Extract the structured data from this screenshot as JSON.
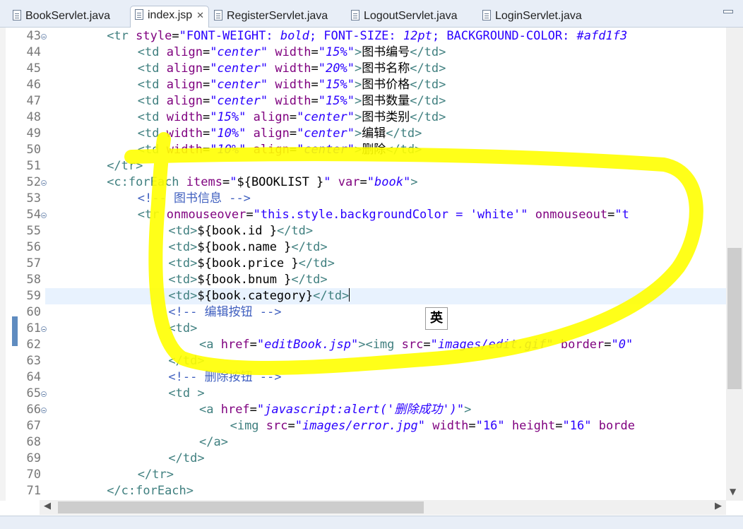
{
  "tabs": [
    {
      "label": "BookServlet.java",
      "active": false
    },
    {
      "label": "index.jsp",
      "active": true,
      "close": "✕"
    },
    {
      "label": "RegisterServlet.java",
      "active": false
    },
    {
      "label": "LogoutServlet.java",
      "active": false
    },
    {
      "label": "LoginServlet.java",
      "active": false
    }
  ],
  "editor": {
    "line_numbers": [
      "43",
      "44",
      "45",
      "46",
      "47",
      "48",
      "49",
      "50",
      "51",
      "52",
      "53",
      "54",
      "55",
      "56",
      "57",
      "58",
      "59",
      "60",
      "61",
      "62",
      "63",
      "64",
      "65",
      "66",
      "67",
      "68",
      "69",
      "70",
      "71"
    ],
    "current_line": "59"
  },
  "ime_indicator": "英",
  "colors": {
    "tag": "#3f7f7f",
    "attribute": "#7f007f",
    "string": "#2a00ff",
    "comment": "#3f5fbf",
    "highlight": "#ffff00",
    "current_line_bg": "#e8f2fe"
  },
  "code": [
    {
      "n": "43",
      "indent": 8,
      "fold": true,
      "parts": [
        [
          "t",
          "<tr "
        ],
        [
          "a",
          "style"
        ],
        [
          "x",
          "="
        ],
        [
          "sn",
          "\"FONT-WEIGHT: "
        ],
        [
          "s",
          "bold"
        ],
        [
          "sn",
          "; FONT-SIZE: "
        ],
        [
          "s",
          "12pt"
        ],
        [
          "sn",
          "; BACKGROUND-COLOR: "
        ],
        [
          "s",
          "#afd1f3"
        ]
      ]
    },
    {
      "n": "44",
      "indent": 12,
      "parts": [
        [
          "t",
          "<td "
        ],
        [
          "a",
          "align"
        ],
        [
          "x",
          "="
        ],
        [
          "s",
          "\"center\""
        ],
        [
          "x",
          " "
        ],
        [
          "a",
          "width"
        ],
        [
          "x",
          "="
        ],
        [
          "s",
          "\"15%\""
        ],
        [
          "t",
          ">"
        ],
        [
          "x",
          "图书编号"
        ],
        [
          "t",
          "</td>"
        ]
      ]
    },
    {
      "n": "45",
      "indent": 12,
      "parts": [
        [
          "t",
          "<td "
        ],
        [
          "a",
          "align"
        ],
        [
          "x",
          "="
        ],
        [
          "s",
          "\"center\""
        ],
        [
          "x",
          " "
        ],
        [
          "a",
          "width"
        ],
        [
          "x",
          "="
        ],
        [
          "s",
          "\"20%\""
        ],
        [
          "t",
          ">"
        ],
        [
          "x",
          "图书名称"
        ],
        [
          "t",
          "</td>"
        ]
      ]
    },
    {
      "n": "46",
      "indent": 12,
      "parts": [
        [
          "t",
          "<td "
        ],
        [
          "a",
          "align"
        ],
        [
          "x",
          "="
        ],
        [
          "s",
          "\"center\""
        ],
        [
          "x",
          " "
        ],
        [
          "a",
          "width"
        ],
        [
          "x",
          "="
        ],
        [
          "s",
          "\"15%\""
        ],
        [
          "t",
          ">"
        ],
        [
          "x",
          "图书价格"
        ],
        [
          "t",
          "</td>"
        ]
      ]
    },
    {
      "n": "47",
      "indent": 12,
      "parts": [
        [
          "t",
          "<td "
        ],
        [
          "a",
          "align"
        ],
        [
          "x",
          "="
        ],
        [
          "s",
          "\"center\""
        ],
        [
          "x",
          " "
        ],
        [
          "a",
          "width"
        ],
        [
          "x",
          "="
        ],
        [
          "s",
          "\"15%\""
        ],
        [
          "t",
          ">"
        ],
        [
          "x",
          "图书数量"
        ],
        [
          "t",
          "</td>"
        ]
      ]
    },
    {
      "n": "48",
      "indent": 12,
      "parts": [
        [
          "t",
          "<td "
        ],
        [
          "a",
          "width"
        ],
        [
          "x",
          "="
        ],
        [
          "s",
          "\"15%\""
        ],
        [
          "x",
          " "
        ],
        [
          "a",
          "align"
        ],
        [
          "x",
          "="
        ],
        [
          "s",
          "\"center\""
        ],
        [
          "t",
          ">"
        ],
        [
          "x",
          "图书类别"
        ],
        [
          "t",
          "</td>"
        ]
      ]
    },
    {
      "n": "49",
      "indent": 12,
      "parts": [
        [
          "t",
          "<td "
        ],
        [
          "a",
          "width"
        ],
        [
          "x",
          "="
        ],
        [
          "s",
          "\"10%\""
        ],
        [
          "x",
          " "
        ],
        [
          "a",
          "align"
        ],
        [
          "x",
          "="
        ],
        [
          "s",
          "\"center\""
        ],
        [
          "t",
          ">"
        ],
        [
          "x",
          "编辑"
        ],
        [
          "t",
          "</td>"
        ]
      ]
    },
    {
      "n": "50",
      "indent": 12,
      "parts": [
        [
          "t",
          "<td "
        ],
        [
          "a",
          "width"
        ],
        [
          "x",
          "="
        ],
        [
          "s",
          "\"10%\""
        ],
        [
          "x",
          " "
        ],
        [
          "a",
          "align"
        ],
        [
          "x",
          "="
        ],
        [
          "s",
          "\"center\""
        ],
        [
          "t",
          ">"
        ],
        [
          "x",
          "删除"
        ],
        [
          "t",
          "</td>"
        ]
      ]
    },
    {
      "n": "51",
      "indent": 8,
      "parts": [
        [
          "t",
          "</tr>"
        ]
      ]
    },
    {
      "n": "52",
      "indent": 8,
      "fold": true,
      "parts": [
        [
          "t",
          "<c:forEach "
        ],
        [
          "a",
          "items"
        ],
        [
          "x",
          "="
        ],
        [
          "sn",
          "\""
        ],
        [
          "x",
          "${BOOKLIST }"
        ],
        [
          "sn",
          "\""
        ],
        [
          "x",
          " "
        ],
        [
          "a",
          "var"
        ],
        [
          "x",
          "="
        ],
        [
          "s",
          "\"book\""
        ],
        [
          "t",
          ">"
        ]
      ]
    },
    {
      "n": "53",
      "indent": 12,
      "parts": [
        [
          "c",
          "<!-- 图书信息 -->"
        ]
      ]
    },
    {
      "n": "54",
      "indent": 12,
      "fold": true,
      "parts": [
        [
          "t",
          "<tr "
        ],
        [
          "a",
          "onmouseover"
        ],
        [
          "x",
          "="
        ],
        [
          "sn",
          "\"this.style.backgroundColor = 'white'\""
        ],
        [
          "x",
          " "
        ],
        [
          "a",
          "onmouseout"
        ],
        [
          "x",
          "="
        ],
        [
          "sn",
          "\"t"
        ]
      ]
    },
    {
      "n": "55",
      "indent": 16,
      "parts": [
        [
          "t",
          "<td>"
        ],
        [
          "x",
          "${book.id }"
        ],
        [
          "t",
          "</td>"
        ]
      ]
    },
    {
      "n": "56",
      "indent": 16,
      "parts": [
        [
          "t",
          "<td>"
        ],
        [
          "x",
          "${book.name }"
        ],
        [
          "t",
          "</td>"
        ]
      ]
    },
    {
      "n": "57",
      "indent": 16,
      "parts": [
        [
          "t",
          "<td>"
        ],
        [
          "x",
          "${book.price }"
        ],
        [
          "t",
          "</td>"
        ]
      ]
    },
    {
      "n": "58",
      "indent": 16,
      "parts": [
        [
          "t",
          "<td>"
        ],
        [
          "x",
          "${book.bnum }"
        ],
        [
          "t",
          "</td>"
        ]
      ]
    },
    {
      "n": "59",
      "indent": 16,
      "parts": [
        [
          "t",
          "<td>"
        ],
        [
          "x",
          "${book.category}"
        ],
        [
          "t",
          "</td>"
        ]
      ]
    },
    {
      "n": "60",
      "indent": 16,
      "parts": [
        [
          "c",
          "<!-- 编辑按钮 -->"
        ]
      ]
    },
    {
      "n": "61",
      "indent": 16,
      "fold": true,
      "parts": [
        [
          "t",
          "<td>"
        ]
      ]
    },
    {
      "n": "62",
      "indent": 20,
      "parts": [
        [
          "t",
          "<a "
        ],
        [
          "a",
          "href"
        ],
        [
          "x",
          "="
        ],
        [
          "s",
          "\"editBook.jsp\""
        ],
        [
          "t",
          "><img "
        ],
        [
          "a",
          "src"
        ],
        [
          "x",
          "="
        ],
        [
          "s",
          "\"images/edit.gif\""
        ],
        [
          "x",
          " "
        ],
        [
          "a",
          "border"
        ],
        [
          "x",
          "="
        ],
        [
          "s",
          "\"0\""
        ]
      ]
    },
    {
      "n": "63",
      "indent": 16,
      "parts": [
        [
          "t",
          "</td>"
        ]
      ]
    },
    {
      "n": "64",
      "indent": 16,
      "parts": [
        [
          "c",
          "<!-- 删除按钮 -->"
        ]
      ]
    },
    {
      "n": "65",
      "indent": 16,
      "fold": true,
      "parts": [
        [
          "t",
          "<td >"
        ]
      ]
    },
    {
      "n": "66",
      "indent": 20,
      "fold": true,
      "parts": [
        [
          "t",
          "<a "
        ],
        [
          "a",
          "href"
        ],
        [
          "x",
          "="
        ],
        [
          "s",
          "\"javascript:alert('删除成功')\""
        ],
        [
          "t",
          ">"
        ]
      ]
    },
    {
      "n": "67",
      "indent": 24,
      "parts": [
        [
          "t",
          "<img "
        ],
        [
          "a",
          "src"
        ],
        [
          "x",
          "="
        ],
        [
          "s",
          "\"images/error.jpg\""
        ],
        [
          "x",
          " "
        ],
        [
          "a",
          "width"
        ],
        [
          "x",
          "="
        ],
        [
          "sn",
          "\"16\""
        ],
        [
          "x",
          " "
        ],
        [
          "a",
          "height"
        ],
        [
          "x",
          "="
        ],
        [
          "sn",
          "\"16\""
        ],
        [
          "x",
          " "
        ],
        [
          "a",
          "borde"
        ]
      ]
    },
    {
      "n": "68",
      "indent": 20,
      "parts": [
        [
          "t",
          "</a>"
        ]
      ]
    },
    {
      "n": "69",
      "indent": 16,
      "parts": [
        [
          "t",
          "</td>"
        ]
      ]
    },
    {
      "n": "70",
      "indent": 12,
      "parts": [
        [
          "t",
          "</tr>"
        ]
      ]
    },
    {
      "n": "71",
      "indent": 8,
      "parts": [
        [
          "t",
          "</c:forEach>"
        ]
      ]
    }
  ]
}
